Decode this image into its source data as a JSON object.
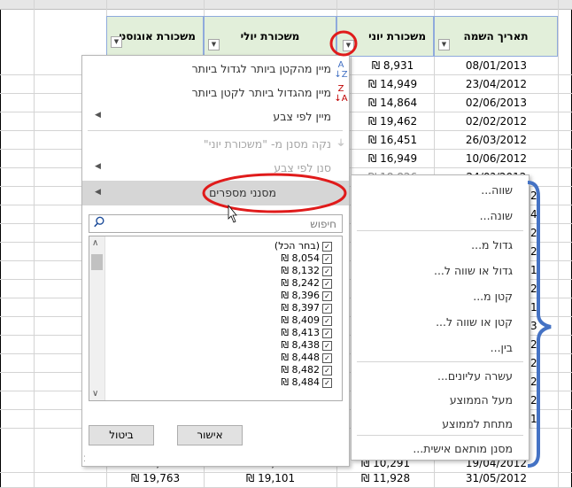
{
  "sheet": {
    "headers": {
      "date": "תאריך השמה",
      "june": "משכורת יוני",
      "july": "משכורת יולי",
      "august": "משכורת אוגוסט"
    },
    "rows": [
      {
        "date": "08/01/2013",
        "june": "₪ 8,931"
      },
      {
        "date": "23/04/2012",
        "june": "₪ 14,949"
      },
      {
        "date": "02/06/2013",
        "june": "₪ 14,864"
      },
      {
        "date": "02/02/2012",
        "june": "₪ 19,462"
      },
      {
        "date": "26/03/2012",
        "june": "₪ 16,451"
      },
      {
        "date": "10/06/2012",
        "june": "₪ 16,949"
      },
      {
        "date": "24/0?/2012",
        "june": "₪ 18,826"
      }
    ],
    "partial_dates": [
      "2",
      "4",
      "2",
      "2",
      "1",
      "2",
      "1",
      "3",
      "2",
      "2",
      "2",
      "2",
      "1"
    ],
    "bottom_rows": [
      {
        "aug": "₪ 19,281",
        "jul": "₪ 10,024",
        "jun": "₪ 10,291",
        "date": "19/04/2012"
      },
      {
        "aug": "₪ 19,763",
        "jul": "₪ 19,101",
        "jun": "₪ 11,928",
        "date": "31/05/2012"
      }
    ]
  },
  "filter_menu": {
    "sort_asc": "מיין מהקטן ביותר לגדול ביותר",
    "sort_desc": "מיין מהגדול ביותר לקטן ביותר",
    "sort_color": "מיין לפי צבע",
    "clear_filter": "נקה מסנן מ- \"משכורת יוני\"",
    "filter_color": "סנן לפי צבע",
    "number_filters": "מסנני מספרים",
    "search_placeholder": "חיפוש",
    "select_all": "(בחר הכל)",
    "values": [
      "8,054 ₪",
      "8,132 ₪",
      "8,242 ₪",
      "8,396 ₪",
      "8,397 ₪",
      "8,409 ₪",
      "8,413 ₪",
      "8,438 ₪",
      "8,448 ₪",
      "8,482 ₪",
      "8,484 ₪"
    ],
    "ok": "אישור",
    "cancel": "ביטול"
  },
  "number_filter_submenu": [
    "שווה...",
    "שונה...",
    "גדול מ...",
    "גדול או שווה ל...",
    "קטן מ...",
    "קטן או שווה ל...",
    "בין...",
    "עשרה עליונים...",
    "מעל הממוצע",
    "מתחת לממוצע",
    "מסנן מותאם אישית..."
  ],
  "colors": {
    "header_bg": "#e2efda",
    "annotation_red": "#e01b1b",
    "annotation_blue": "#4472c4",
    "highlight": "#d6d6d6"
  },
  "icons": [
    "sort-asc-icon",
    "sort-desc-icon",
    "clear-filter-icon",
    "search-icon",
    "dropdown-arrow-icon",
    "submenu-arrow-icon",
    "mouse-cursor-icon"
  ]
}
